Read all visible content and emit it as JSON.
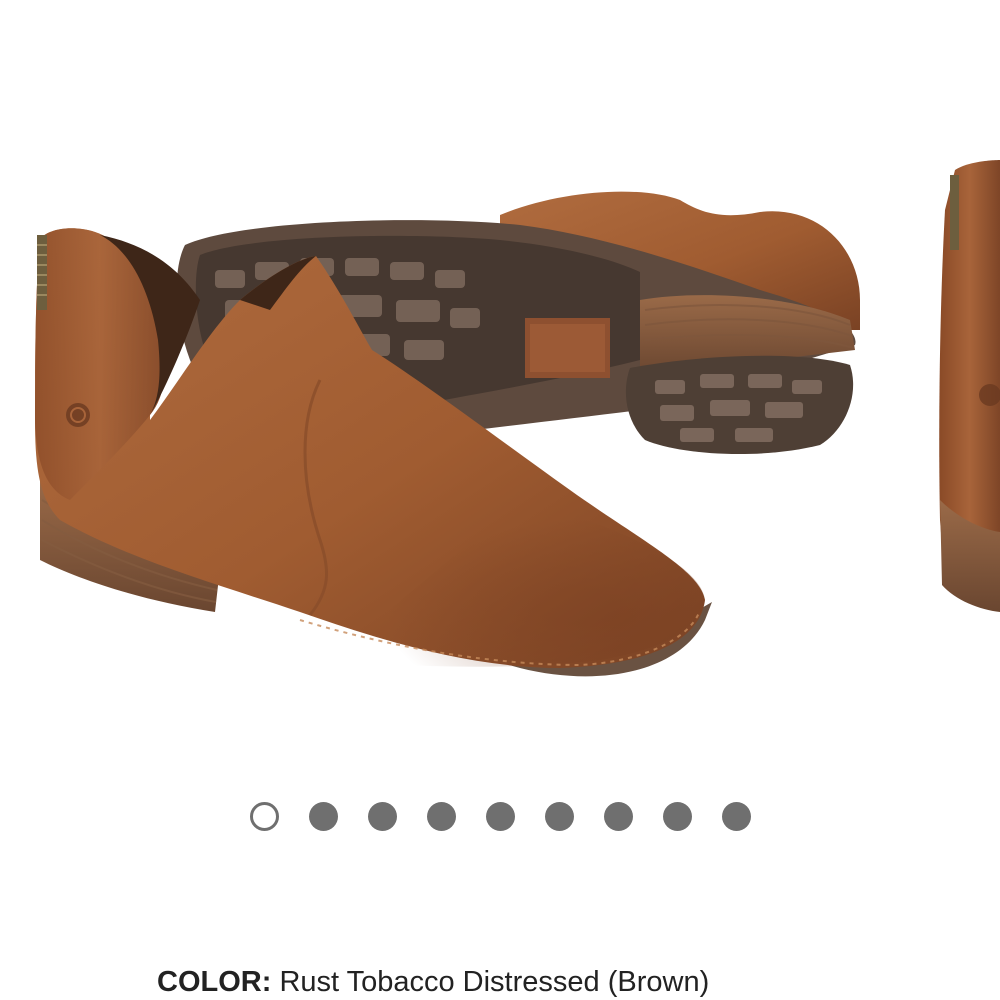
{
  "carousel": {
    "slide_count": 9,
    "active_index": 0,
    "slide_image": "rust-tobacco-ankle-boot-pair",
    "next_slide_image": "boot-side-peek"
  },
  "color": {
    "label": "COLOR:",
    "value": "Rust Tobacco Distressed (Brown)"
  },
  "colors": {
    "suede": "#A15E33",
    "sole": "#5E4A3E",
    "dot": "#6F6F6F"
  }
}
